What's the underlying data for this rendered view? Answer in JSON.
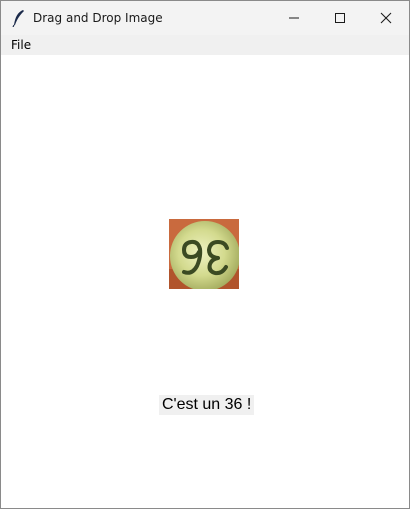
{
  "window": {
    "title": "Drag and Drop Image"
  },
  "titlebar": {
    "icons": [
      "feather-icon",
      "minimize-icon",
      "maximize-icon",
      "close-icon"
    ]
  },
  "menubar": {
    "items": [
      {
        "label": "File"
      }
    ]
  },
  "main": {
    "image_icon": "digit-photo",
    "result_text": "C'est un 36 !"
  },
  "colors": {
    "titlebar_bg": "#f3f3f3",
    "menubar_bg": "#f0f0f0",
    "content_bg": "#ffffff",
    "label_bg": "#f0f0f0"
  }
}
